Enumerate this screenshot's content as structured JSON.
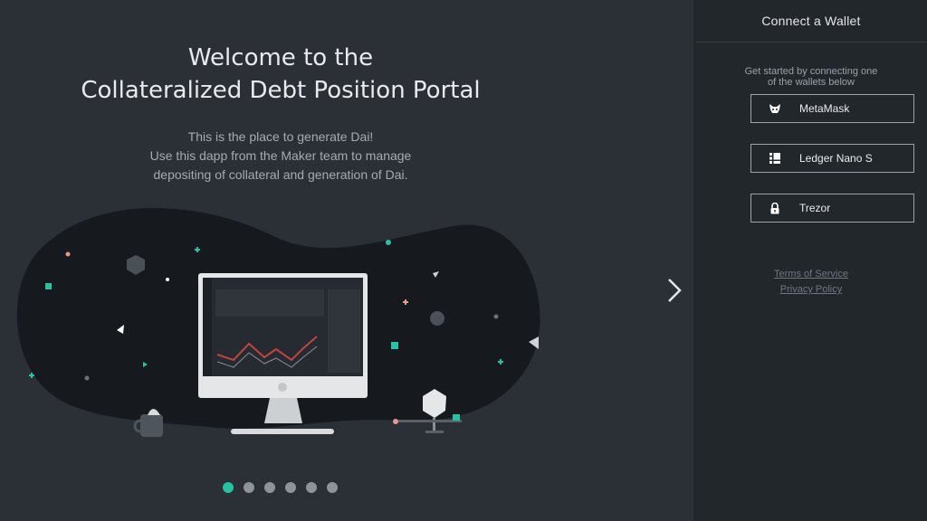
{
  "hero": {
    "title_line1": "Welcome to the",
    "title_line2": "Collateralized Debt Position Portal",
    "subtitle_line1": "This is the place to generate Dai!",
    "subtitle_line2": "Use this dapp from the Maker team to manage",
    "subtitle_line3": "depositing of collateral and generation of Dai."
  },
  "carousel": {
    "next_icon": "chevron-right-icon",
    "dots": [
      {
        "active": true
      },
      {
        "active": false
      },
      {
        "active": false
      },
      {
        "active": false
      },
      {
        "active": false
      },
      {
        "active": false
      }
    ]
  },
  "wallet_panel": {
    "header": "Connect a Wallet",
    "intro": "Get started by connecting one of the wallets below",
    "wallets": [
      {
        "label": "MetaMask",
        "icon": "metamask-fox-icon"
      },
      {
        "label": "Ledger Nano S",
        "icon": "ledger-icon"
      },
      {
        "label": "Trezor",
        "icon": "lock-icon"
      }
    ],
    "terms": "Terms of Service",
    "privacy": "Privacy Policy"
  },
  "colors": {
    "accent": "#27c2a2",
    "background_left": "#2a3036",
    "background_right": "#22272c",
    "blob": "#161a1f"
  }
}
